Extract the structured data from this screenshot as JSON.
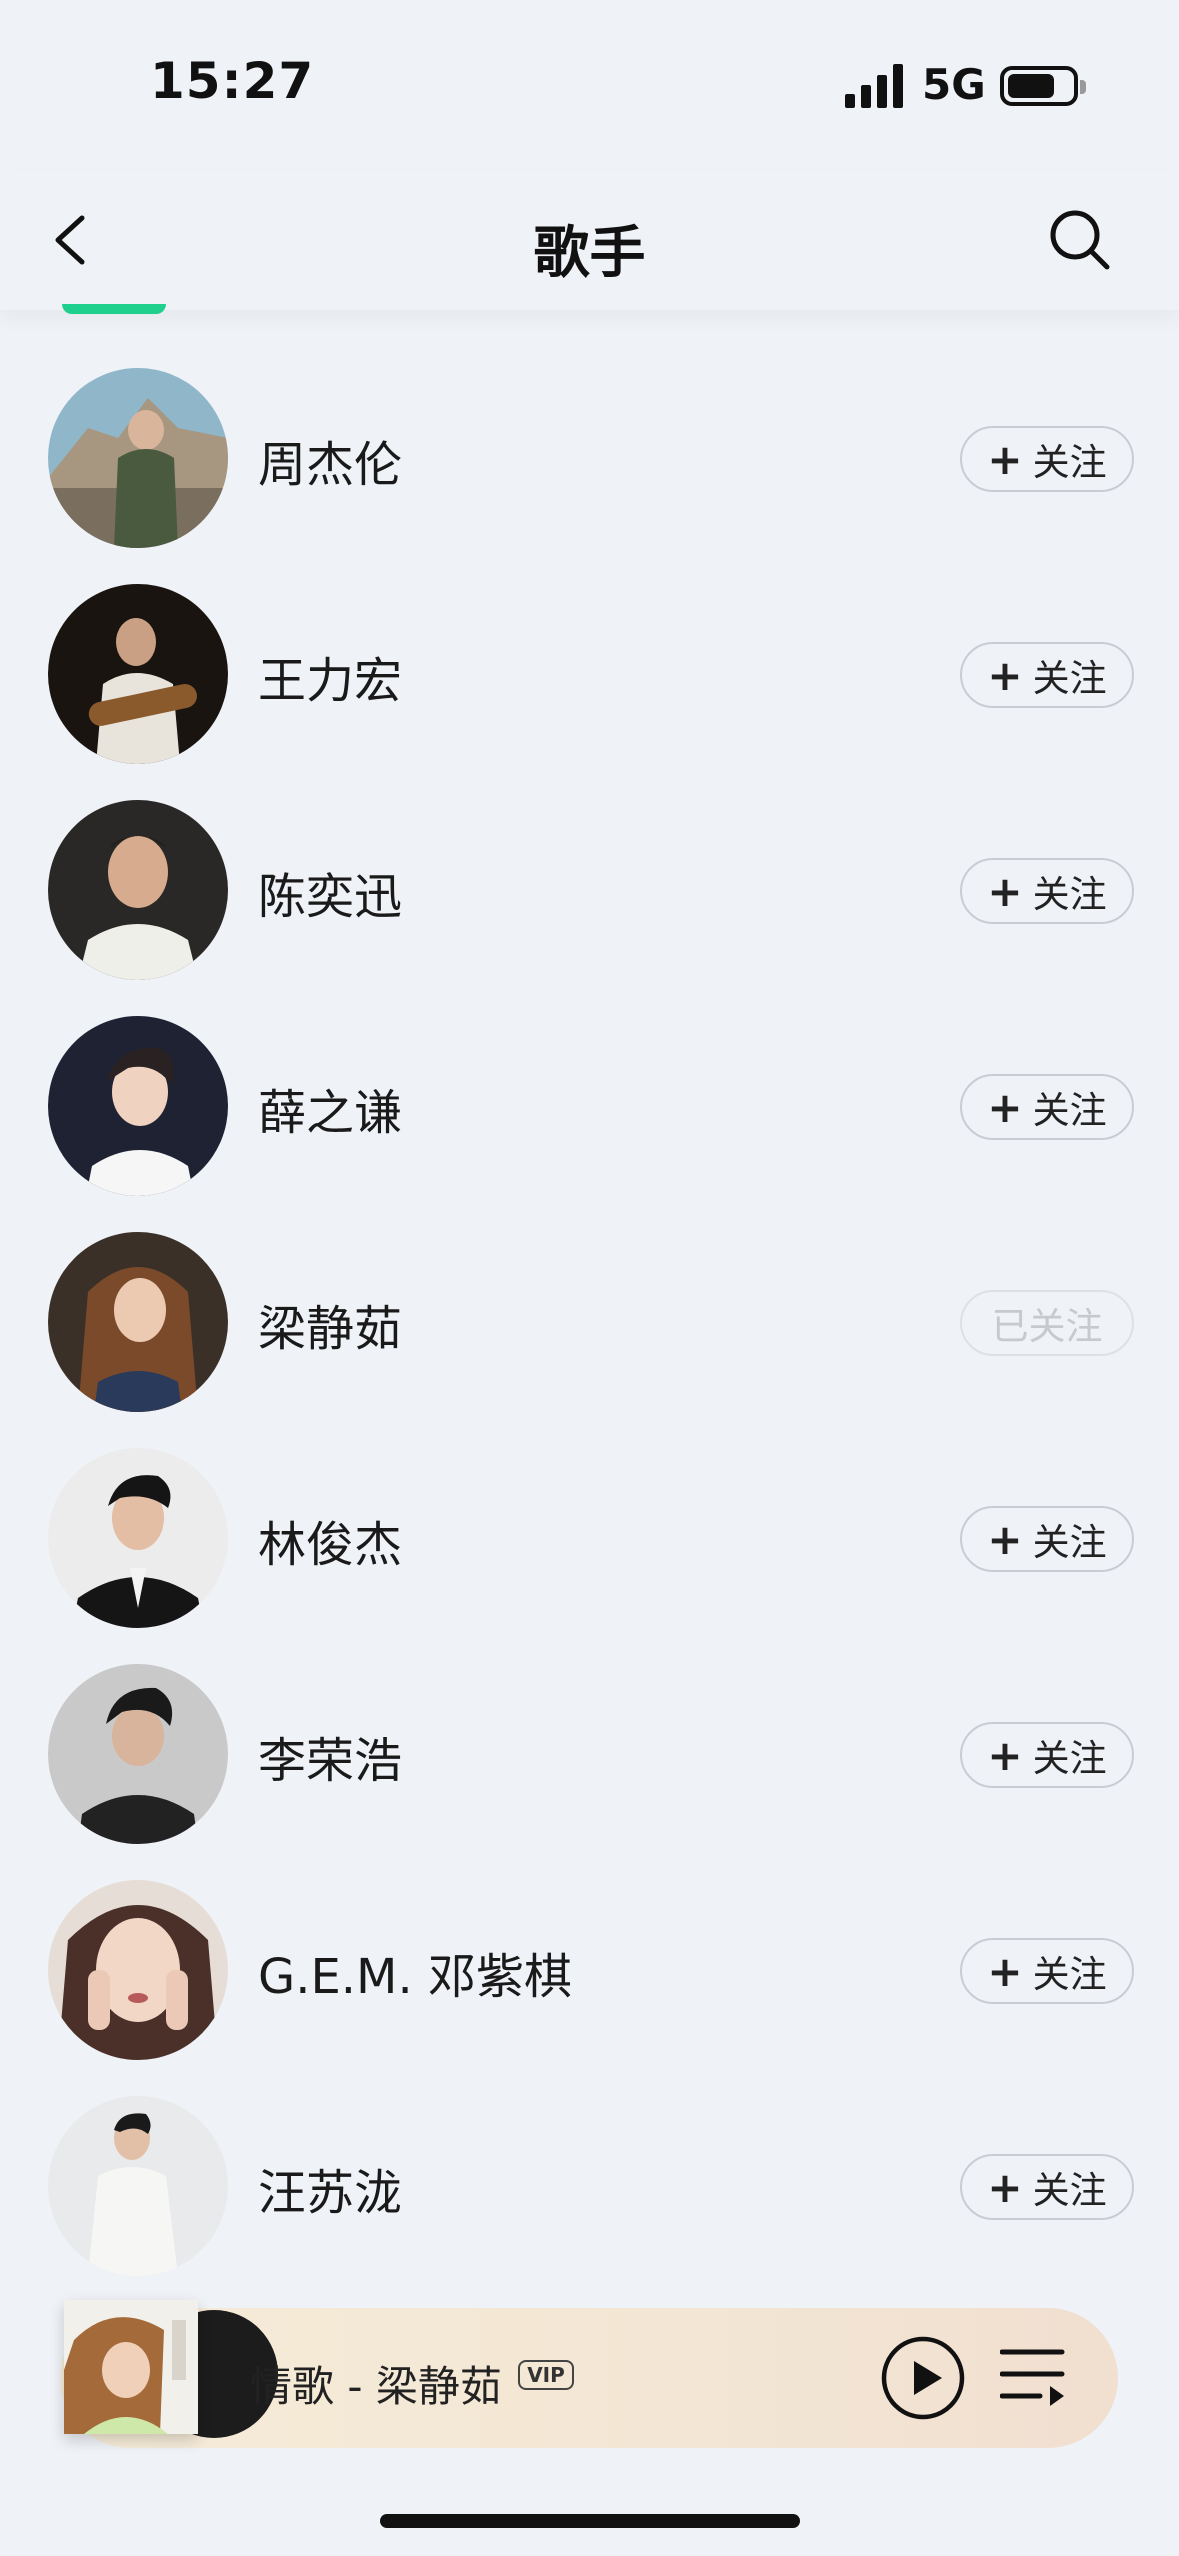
{
  "status_bar": {
    "time": "15:27",
    "network": "5G"
  },
  "header": {
    "title": "歌手",
    "back_icon": "chevron-left-icon",
    "search_icon": "search-icon"
  },
  "artists": [
    {
      "name": "周杰伦",
      "follow_label": "关注",
      "followed": false
    },
    {
      "name": "王力宏",
      "follow_label": "关注",
      "followed": false
    },
    {
      "name": "陈奕迅",
      "follow_label": "关注",
      "followed": false
    },
    {
      "name": "薛之谦",
      "follow_label": "关注",
      "followed": false
    },
    {
      "name": "梁静茹",
      "follow_label": "已关注",
      "followed": true
    },
    {
      "name": "林俊杰",
      "follow_label": "关注",
      "followed": false
    },
    {
      "name": "李荣浩",
      "follow_label": "关注",
      "followed": false
    },
    {
      "name": "G.E.M. 邓紫棋",
      "follow_label": "关注",
      "followed": false
    },
    {
      "name": "汪苏泷",
      "follow_label": "关注",
      "followed": false
    }
  ],
  "plus_symbol": "+",
  "player": {
    "title": "情歌 - 梁静茹",
    "vip": "VIP",
    "play_icon": "play-icon",
    "playlist_icon": "playlist-icon"
  },
  "colors": {
    "accent": "#1fcf8c",
    "background": "#eff2f7"
  }
}
